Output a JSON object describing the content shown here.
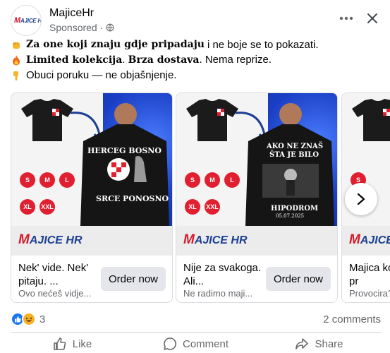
{
  "header": {
    "page_name": "MajiceHr",
    "sponsored": "Sponsored ·",
    "avatar_logo_m": "M",
    "avatar_logo_rest": "AJICE HR"
  },
  "body": {
    "line1_bold": "Za one koji znaju gdje pripadaju",
    "line1_rest": "i ne boje se to pokazati.",
    "line2_bold1": "Limited kolekcija",
    "line2_sep": ".",
    "line2_bold2": "Brza dostava",
    "line2_rest": ". Nema reprize.",
    "line3": "Obuci poruku — ne objašnjenje."
  },
  "cards": [
    {
      "title": "Nek' vide. Nek' pitaju. ...",
      "desc": "Ovo nećeš vidje...",
      "cta": "Order now",
      "shirt_top": "HERCEG BOSNO",
      "shirt_bottom": "SRCE PONOSNO"
    },
    {
      "title": "Nije za svakoga. Ali...",
      "desc": "Ne radimo maji...",
      "cta": "Order now",
      "shirt_top": "AKO NE ZNAŠ",
      "shirt_top2": "ŠTA JE BILO",
      "shirt_bottom": "HIPODROM",
      "shirt_date": "05.07.2025"
    },
    {
      "title": "Majica ko nećeš pr",
      "desc": "Provocira?..."
    }
  ],
  "sizes": [
    "S",
    "M",
    "L",
    "XL",
    "XXL"
  ],
  "brand_logo": {
    "m": "M",
    "rest": "AJICE HR"
  },
  "reactions": {
    "count": "3"
  },
  "comments": {
    "count_label": "2 comments"
  },
  "actions": {
    "like": "Like",
    "comment": "Comment",
    "share": "Share"
  },
  "colors": {
    "facebook_blue": "#1877f2",
    "button_grey": "#e4e6eb",
    "muted_text": "#65676b"
  }
}
